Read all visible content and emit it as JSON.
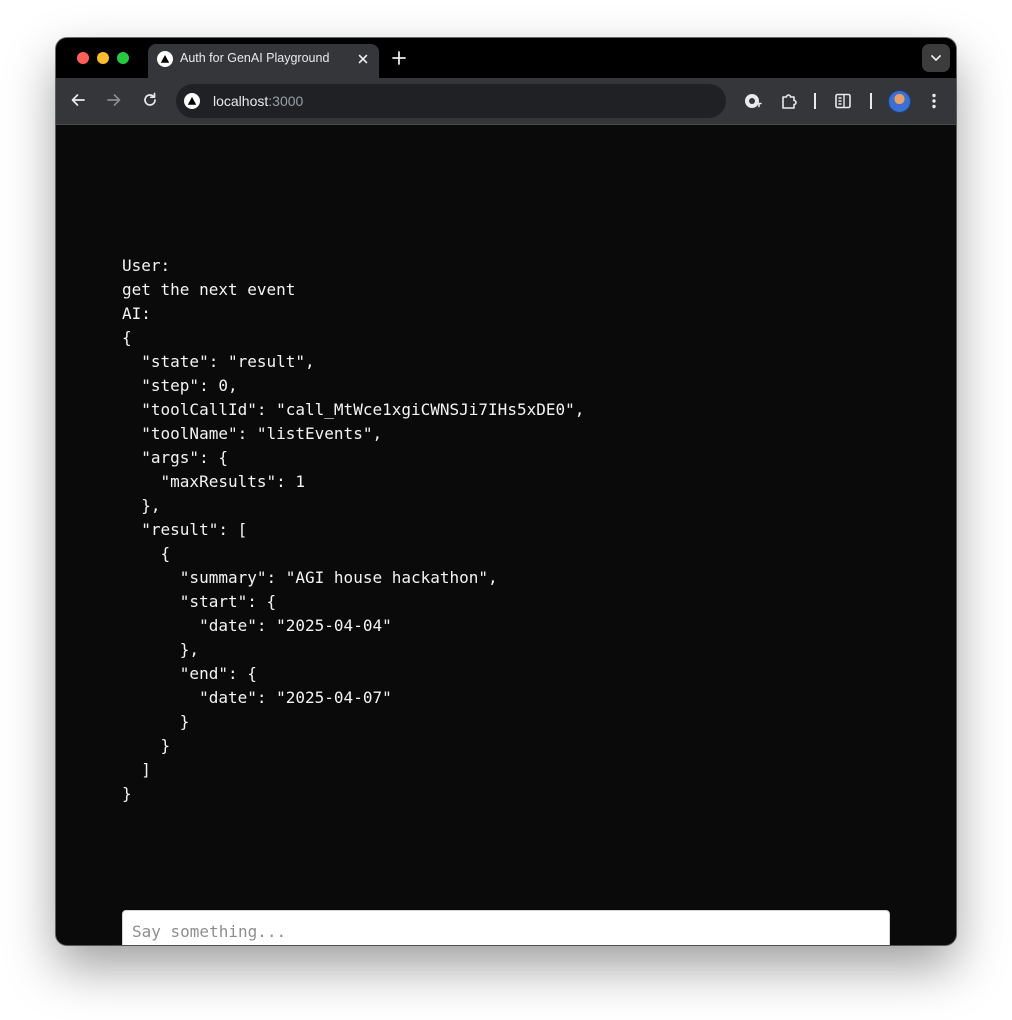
{
  "browser": {
    "tab": {
      "title": "Auth for GenAI Playground",
      "favicon": "triangle-logo-icon"
    },
    "address_bar": {
      "host": "localhost",
      "port": ":3000"
    },
    "icons": {
      "back": "arrow-left-icon",
      "forward": "arrow-right-icon",
      "reload": "reload-icon",
      "password": "password-key-icon",
      "extensions": "puzzle-piece-icon",
      "sidepanel": "side-panel-icon",
      "profile": "profile-avatar",
      "menu": "kebab-menu-icon",
      "new_tab": "plus-icon",
      "close_tab": "close-icon",
      "tab_search": "chevron-down-icon"
    },
    "colors": {
      "tab_strip": "#000000",
      "toolbar": "#35363a",
      "omnibox": "#202124",
      "page_background": "#0a0a0a"
    }
  },
  "chat": {
    "messages": [
      {
        "role_label": "User:",
        "content": "get the next event"
      },
      {
        "role_label": "AI:",
        "content": "{\n  \"state\": \"result\",\n  \"step\": 0,\n  \"toolCallId\": \"call_MtWce1xgiCWNSJi7IHs5xDE0\",\n  \"toolName\": \"listEvents\",\n  \"args\": {\n    \"maxResults\": 1\n  },\n  \"result\": [\n    {\n      \"summary\": \"AGI house hackathon\",\n      \"start\": {\n        \"date\": \"2025-04-04\"\n      },\n      \"end\": {\n        \"date\": \"2025-04-07\"\n      }\n    }\n  ]\n}"
      }
    ],
    "input": {
      "value": "",
      "placeholder": "Say something..."
    }
  }
}
